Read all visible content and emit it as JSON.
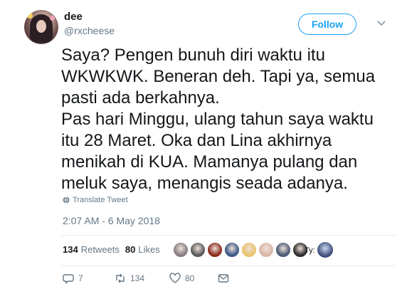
{
  "user": {
    "name": "dee",
    "handle": "@rxcheese"
  },
  "follow_button": {
    "label": "Follow"
  },
  "tweet": {
    "paragraphs": [
      "Saya? Pengen bunuh diri waktu itu WKWKWK. Beneran deh. Tapi ya, semua pasti ada berkahnya.",
      "Pas hari Minggu, ulang tahun saya waktu itu 28 Maret. Oka dan Lina akhirnya menikah di KUA. Mamanya pulang dan meluk saya, menangis seada adanya."
    ]
  },
  "translate_label": "Translate Tweet",
  "timestamp": "2:07 AM - 6 May 2018",
  "stats": {
    "retweets_count": "134",
    "retweets_label": "Retweets",
    "likes_count": "80",
    "likes_label": "Likes"
  },
  "likers_suffix": "Ty:",
  "likers_colors": [
    "#8a7f86",
    "#5b5b5b",
    "#8a2c1f",
    "#3c5a86",
    "#e8c36b",
    "#d9b8a8",
    "#4a5a74",
    "#2d2d2d"
  ],
  "liker_last_color": "#3b4a78",
  "actions": {
    "reply_count": "7",
    "retweet_count": "134",
    "like_count": "80"
  },
  "colors": {
    "accent": "#1da1f2",
    "muted": "#657786",
    "text": "#14171a"
  }
}
